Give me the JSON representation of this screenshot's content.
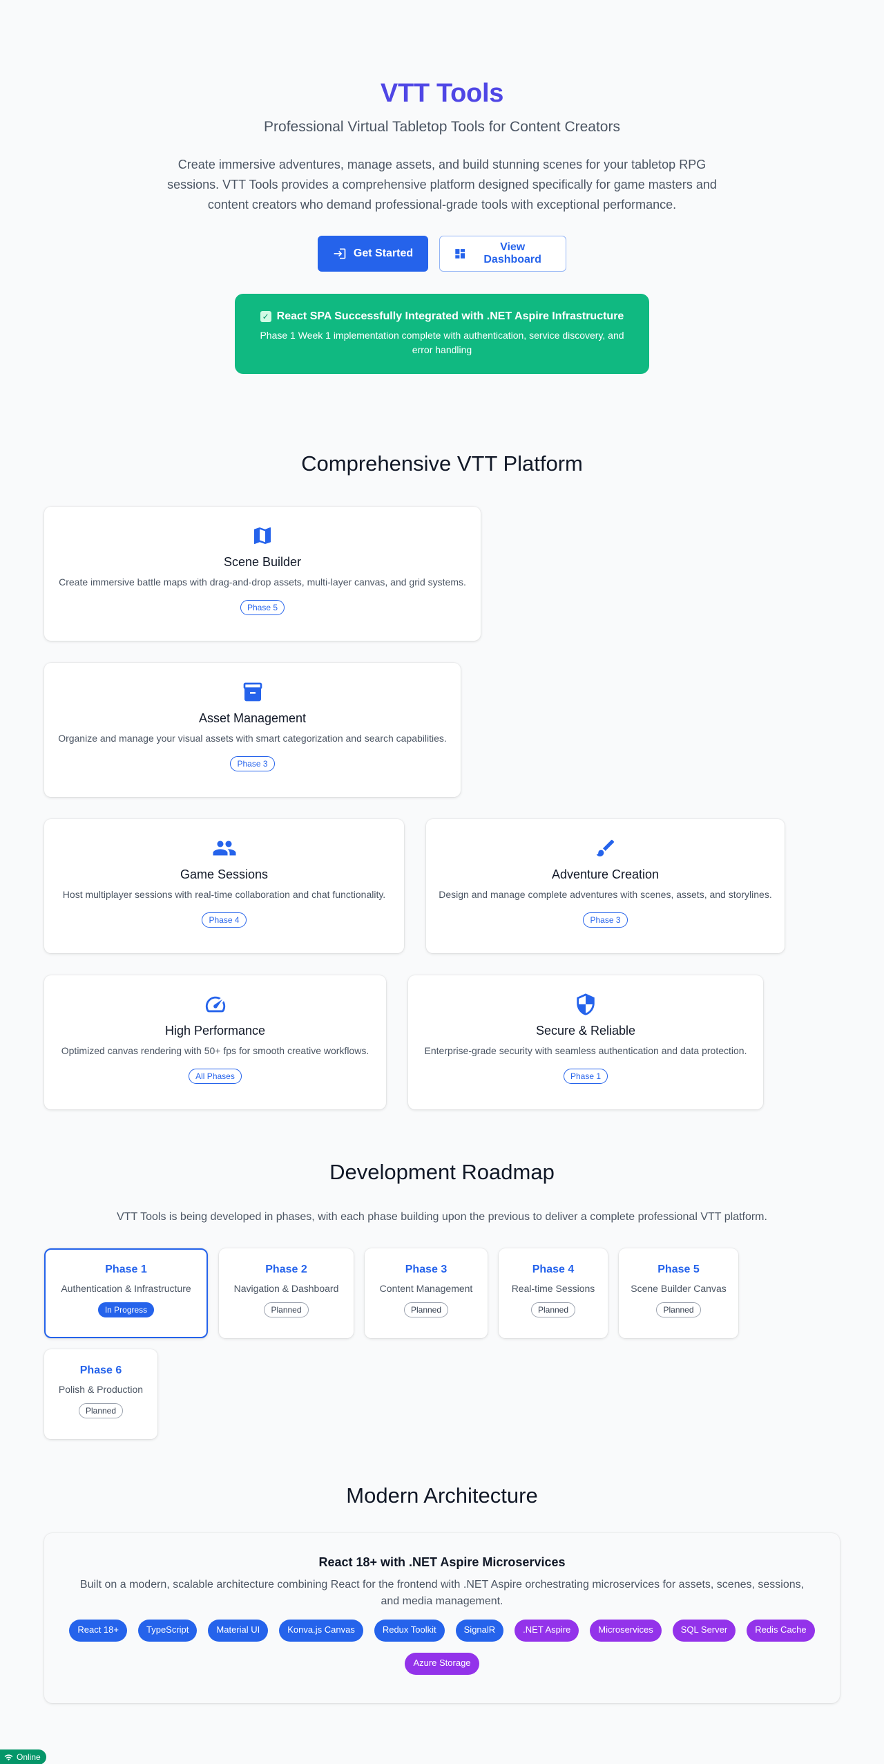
{
  "hero": {
    "title": "VTT Tools",
    "subtitle": "Professional Virtual Tabletop Tools for Content Creators",
    "description": "Create immersive adventures, manage assets, and build stunning scenes for your tabletop RPG sessions. VTT Tools provides a comprehensive platform designed specifically for game masters and content creators who demand professional-grade tools with exceptional performance.",
    "get_started_label": "Get Started",
    "view_dashboard_label": "View Dashboard"
  },
  "success_banner": {
    "title": "React SPA Successfully Integrated with .NET Aspire Infrastructure",
    "subtitle": "Phase 1 Week 1 implementation complete with authentication, service discovery, and error handling"
  },
  "features": {
    "title": "Comprehensive VTT Platform",
    "items": [
      {
        "icon": "map-icon",
        "title": "Scene Builder",
        "description": "Create immersive battle maps with drag-and-drop assets, multi-layer canvas, and grid systems.",
        "phase": "Phase 5"
      },
      {
        "icon": "archive-icon",
        "title": "Asset Management",
        "description": "Organize and manage your visual assets with smart categorization and search capabilities.",
        "phase": "Phase 3"
      },
      {
        "icon": "people-icon",
        "title": "Game Sessions",
        "description": "Host multiplayer sessions with real-time collaboration and chat functionality.",
        "phase": "Phase 4"
      },
      {
        "icon": "brush-icon",
        "title": "Adventure Creation",
        "description": "Design and manage complete adventures with scenes, assets, and storylines.",
        "phase": "Phase 3"
      },
      {
        "icon": "speed-icon",
        "title": "High Performance",
        "description": "Optimized canvas rendering with 50+ fps for smooth creative workflows.",
        "phase": "All Phases"
      },
      {
        "icon": "shield-icon",
        "title": "Secure & Reliable",
        "description": "Enterprise-grade security with seamless authentication and data protection.",
        "phase": "Phase 1"
      }
    ]
  },
  "roadmap": {
    "title": "Development Roadmap",
    "description": "VTT Tools is being developed in phases, with each phase building upon the previous to deliver a complete professional VTT platform.",
    "phases": [
      {
        "name": "Phase 1",
        "description": "Authentication & Infrastructure",
        "status": "In Progress"
      },
      {
        "name": "Phase 2",
        "description": "Navigation & Dashboard",
        "status": "Planned"
      },
      {
        "name": "Phase 3",
        "description": "Content Management",
        "status": "Planned"
      },
      {
        "name": "Phase 4",
        "description": "Real-time Sessions",
        "status": "Planned"
      },
      {
        "name": "Phase 5",
        "description": "Scene Builder Canvas",
        "status": "Planned"
      },
      {
        "name": "Phase 6",
        "description": "Polish & Production",
        "status": "Planned"
      }
    ]
  },
  "architecture": {
    "title": "Modern Architecture",
    "card_title": "React 18+ with .NET Aspire Microservices",
    "card_description": "Built on a modern, scalable architecture combining React for the frontend with .NET Aspire orchestrating microservices for assets, scenes, sessions, and media management.",
    "tech": [
      {
        "label": "React 18+",
        "color": "#2563eb"
      },
      {
        "label": "TypeScript",
        "color": "#2563eb"
      },
      {
        "label": "Material UI",
        "color": "#2563eb"
      },
      {
        "label": "Konva.js Canvas",
        "color": "#2563eb"
      },
      {
        "label": "Redux Toolkit",
        "color": "#2563eb"
      },
      {
        "label": "SignalR",
        "color": "#2563eb"
      },
      {
        "label": ".NET Aspire",
        "color": "#9333ea"
      },
      {
        "label": "Microservices",
        "color": "#9333ea"
      },
      {
        "label": "SQL Server",
        "color": "#9333ea"
      },
      {
        "label": "Redis Cache",
        "color": "#9333ea"
      },
      {
        "label": "Azure Storage",
        "color": "#9333ea"
      }
    ]
  },
  "status": {
    "online_label": "Online"
  },
  "colors": {
    "primary": "#2563eb",
    "title": "#4f46e5",
    "success": "#10b981",
    "secondary": "#9333ea"
  }
}
